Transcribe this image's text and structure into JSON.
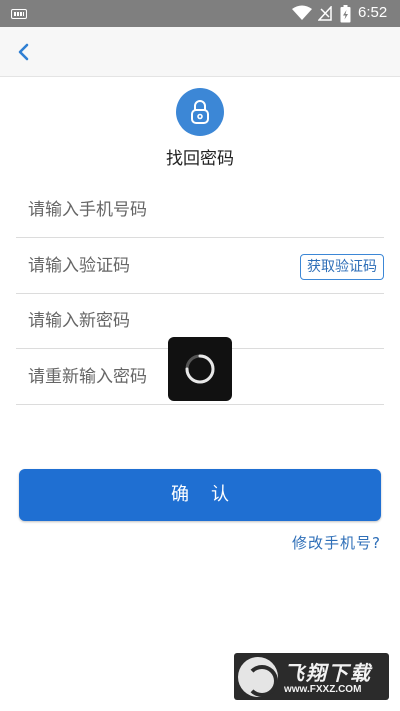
{
  "status_bar": {
    "time": "6:52",
    "icons": [
      "keyboard-icon",
      "wifi-icon",
      "no-signal-icon",
      "battery-charging-icon"
    ]
  },
  "header": {
    "back_icon": "chevron-left-icon"
  },
  "brand": {
    "accent": "#3c87d6",
    "button_color": "#1f6fd2",
    "link_color": "#2f6fb8"
  },
  "page": {
    "title": "找回密码",
    "logo_icon": "lock-icon"
  },
  "form": {
    "phone_placeholder": "请输入手机号码",
    "code_placeholder": "请输入验证码",
    "get_code_label": "获取验证码",
    "new_password_placeholder": "请输入新密码",
    "confirm_password_placeholder": "请重新输入密码"
  },
  "actions": {
    "confirm_label": "确认",
    "change_phone_label": "修改手机号?"
  },
  "watermark": {
    "title": "飞翔下载",
    "url": "www.FXXZ.COM"
  }
}
